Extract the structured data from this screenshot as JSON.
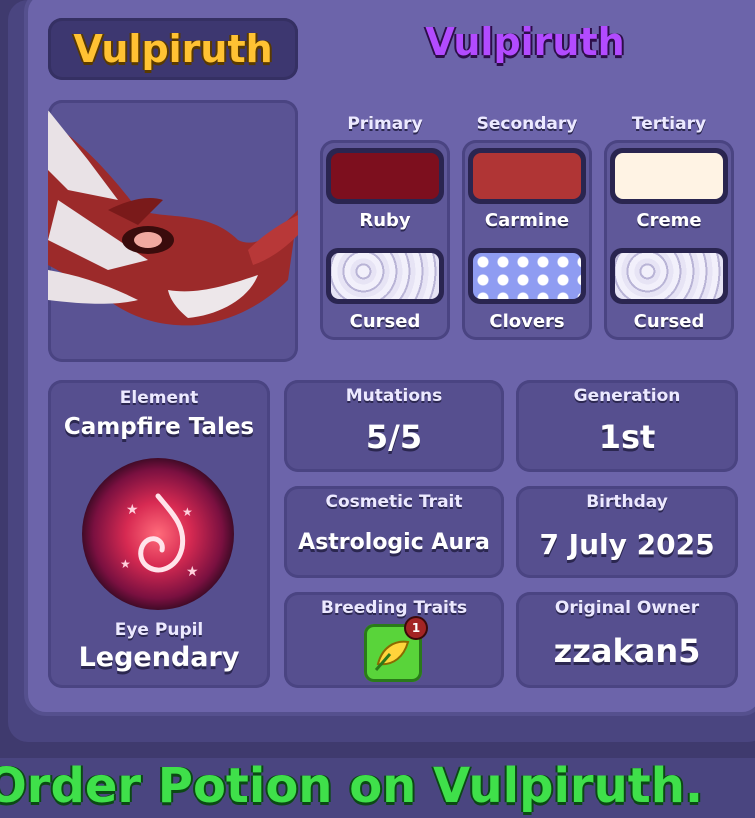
{
  "header": {
    "species_name": "Vulpiruth",
    "display_name": "Vulpiruth"
  },
  "colors": {
    "primary": {
      "heading": "Primary",
      "name": "Ruby",
      "hex": "#7d0f1e"
    },
    "secondary": {
      "heading": "Secondary",
      "name": "Carmine",
      "hex": "#b03535"
    },
    "tertiary": {
      "heading": "Tertiary",
      "name": "Creme",
      "hex": "#fff3e4"
    }
  },
  "patterns": [
    {
      "name": "Cursed",
      "icon": "cursed-pattern"
    },
    {
      "name": "Clovers",
      "icon": "clovers-pattern"
    },
    {
      "name": "Cursed",
      "icon": "cursed-pattern"
    }
  ],
  "element": {
    "label": "Element",
    "value": "Campfire Tales",
    "icon": "campfire-spiral-icon"
  },
  "eye_pupil": {
    "label": "Eye Pupil",
    "value": "Legendary"
  },
  "mutations": {
    "label": "Mutations",
    "value": "5/5"
  },
  "generation": {
    "label": "Generation",
    "value": "1st"
  },
  "cosmetic_trait": {
    "label": "Cosmetic Trait",
    "value": "Astrologic Aura"
  },
  "birthday": {
    "label": "Birthday",
    "value": "7 July 2025"
  },
  "breeding_traits": {
    "label": "Breeding Traits",
    "icon": "breeding-trait-icon",
    "badge": "1"
  },
  "original_owner": {
    "label": "Original Owner",
    "value": "zzakan5"
  },
  "footer": {
    "banner": "Order Potion on Vulpiruth."
  }
}
